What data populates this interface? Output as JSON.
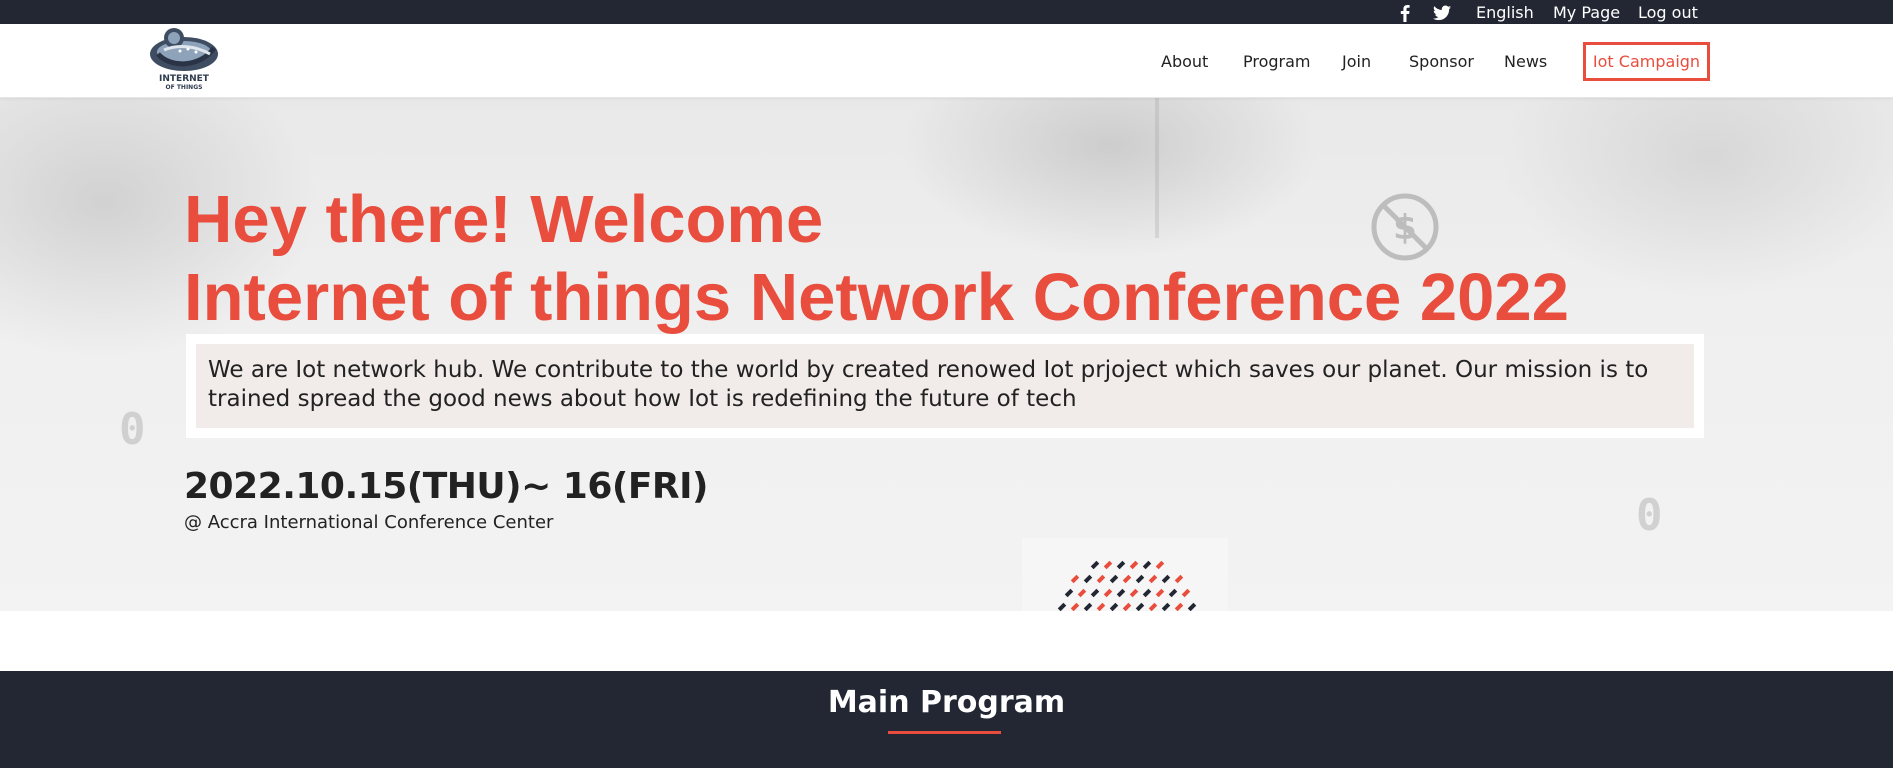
{
  "topbar": {
    "facebook_icon": "facebook-icon",
    "twitter_icon": "twitter-icon",
    "language": "English",
    "my_page": "My Page",
    "logout": "Log out"
  },
  "header": {
    "logo": {
      "line1": "INTERNET",
      "line2": "OF THINGS"
    },
    "nav": [
      "About",
      "Program",
      "Join",
      "Sponsor",
      "News"
    ],
    "cta": "Iot Campaign"
  },
  "hero": {
    "title_line1": "Hey there! Welcome",
    "title_line2": "Internet of things Network Conference 2022",
    "description": "We are Iot network hub. We contribute to the world by created renowed Iot prjoject which saves our planet. Our mission is to trained spread the good news about how Iot is redefining the future of tech",
    "date": "2022.10.15(THU)~ 16(FRI)",
    "venue": "@ Accra International Conference Center"
  },
  "program": {
    "title": "Main Program"
  },
  "colors": {
    "accent": "#e84d3d",
    "dark": "#232733"
  }
}
